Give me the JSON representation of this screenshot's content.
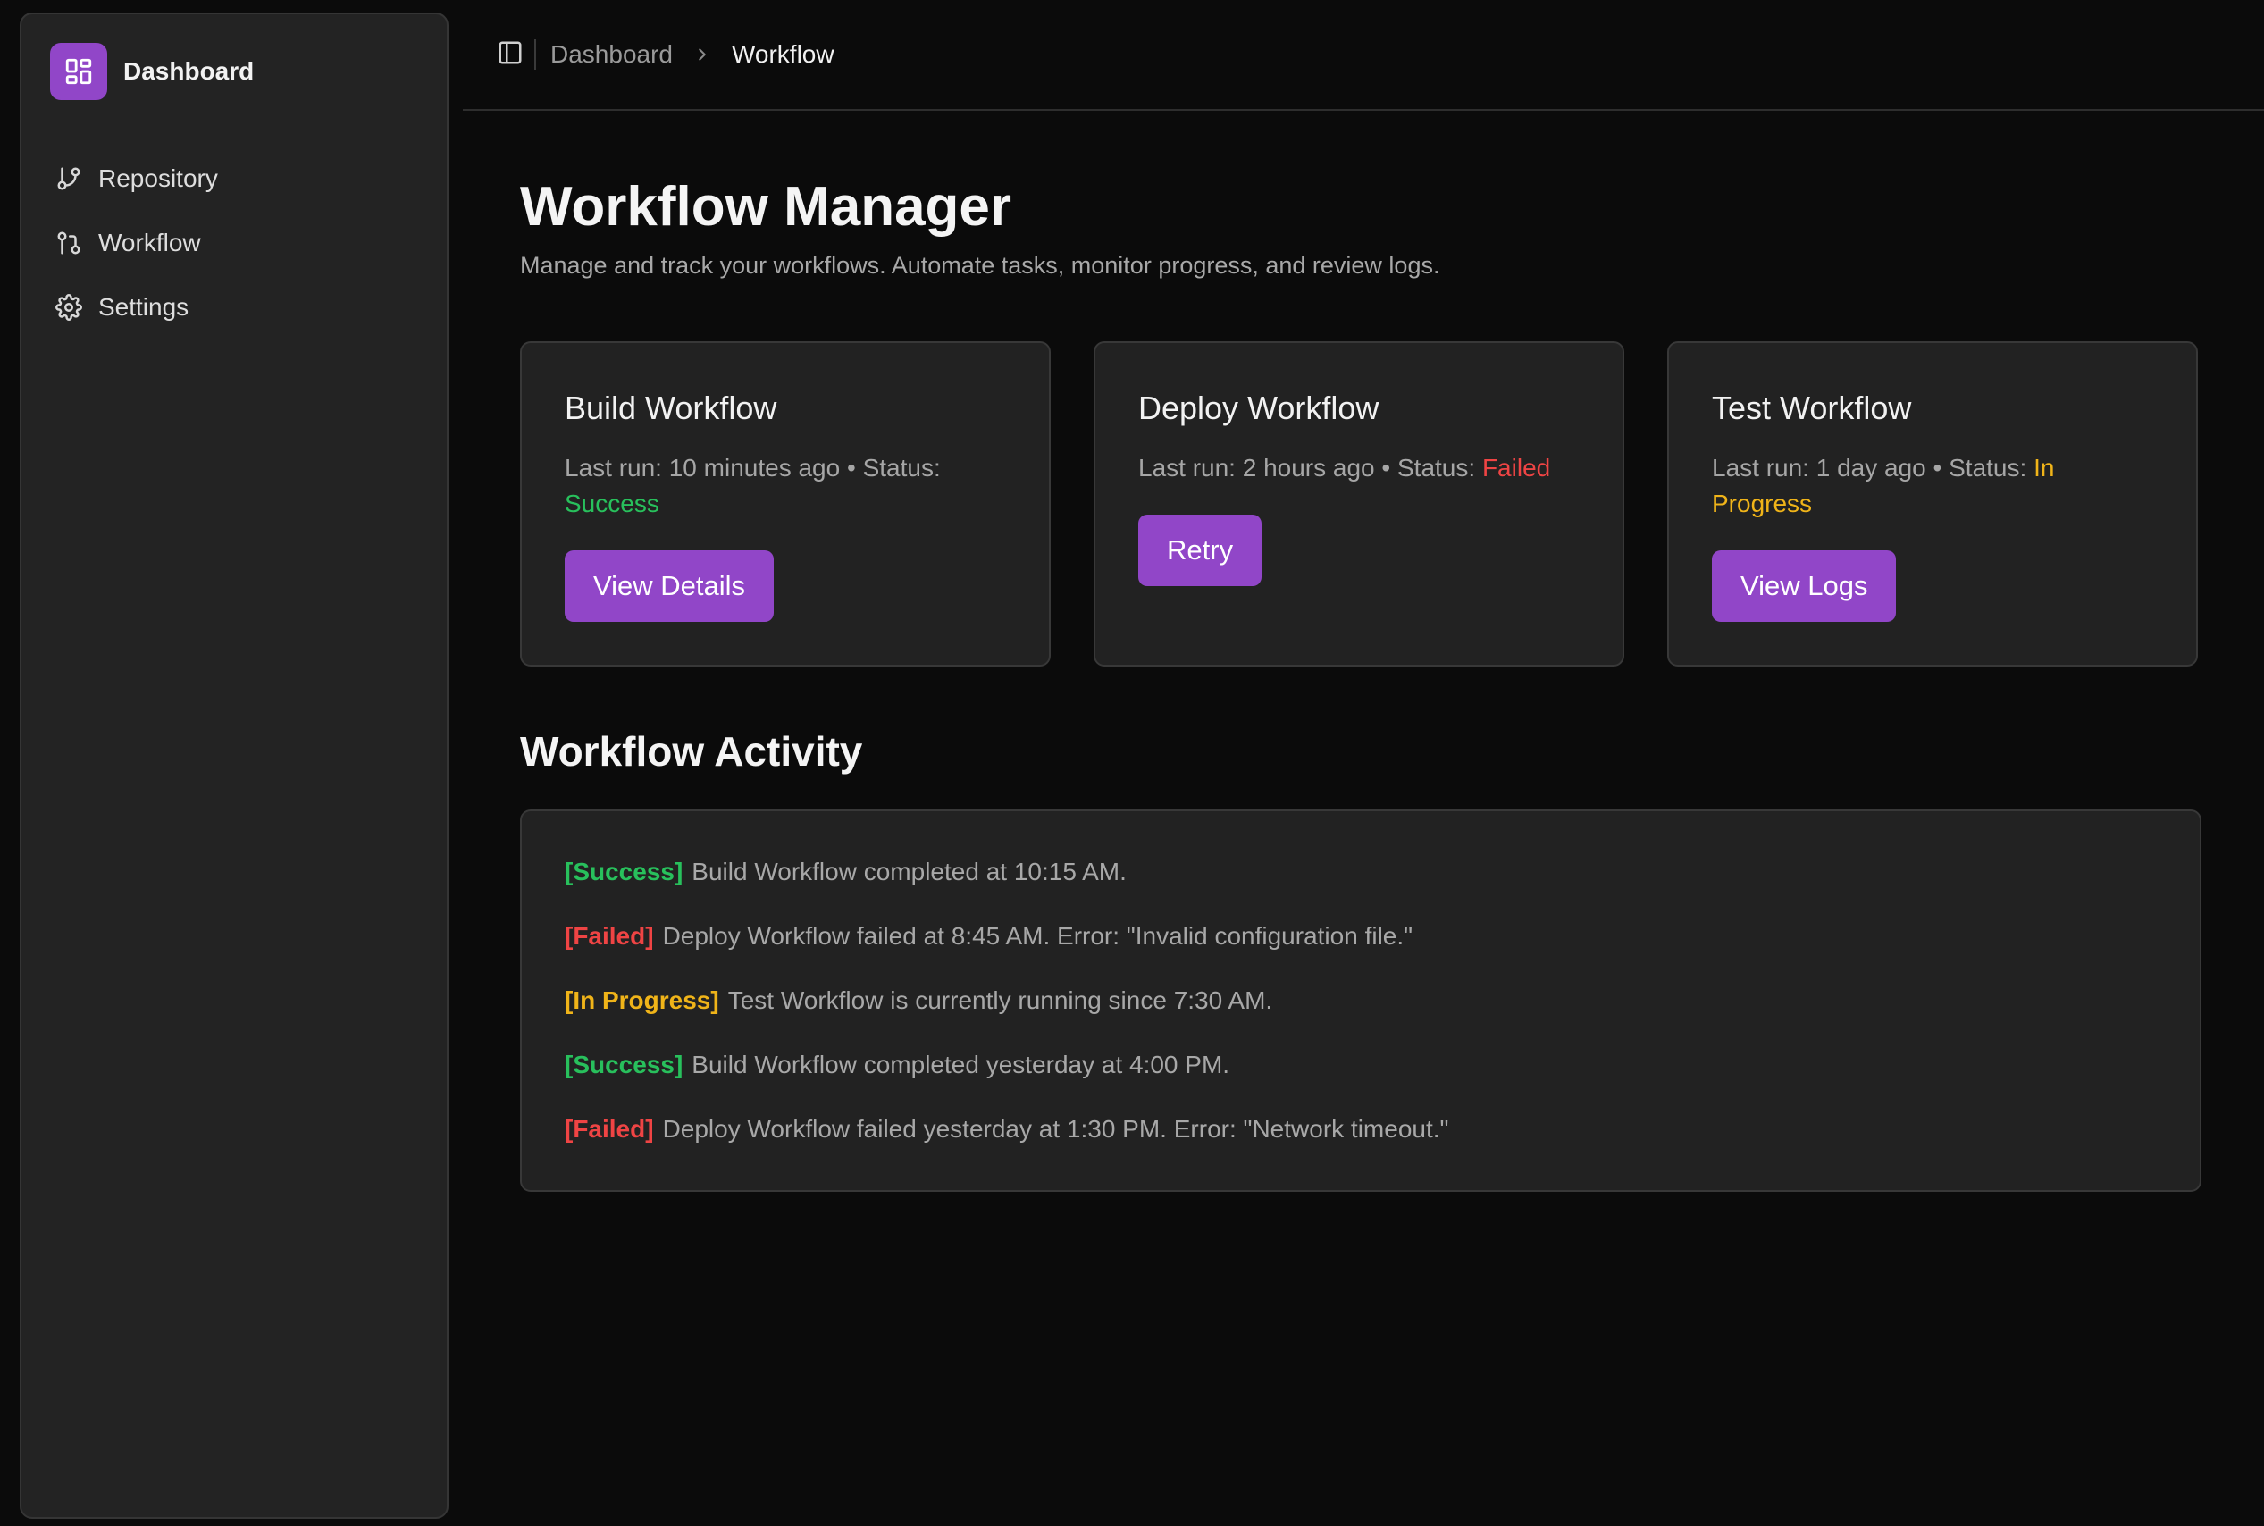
{
  "colors": {
    "accent": "#9146c8",
    "success": "#28c05c",
    "failed": "#ef4444",
    "in_progress": "#f0b419",
    "background": "#0b0b0b",
    "panel": "#232323"
  },
  "sidebar": {
    "brand": {
      "name": "Dashboard",
      "icon": "layout-dashboard-icon"
    },
    "items": [
      {
        "label": "Repository",
        "icon": "git-branch-icon"
      },
      {
        "label": "Workflow",
        "icon": "git-pull-request-icon"
      },
      {
        "label": "Settings",
        "icon": "gear-icon"
      }
    ]
  },
  "header": {
    "toggle_icon": "panel-left-icon",
    "breadcrumb": {
      "parent": "Dashboard",
      "separator_icon": "chevron-right-icon",
      "current": "Workflow"
    }
  },
  "main": {
    "title": "Workflow Manager",
    "subtitle": "Manage and track your workflows. Automate tasks, monitor progress, and review logs.",
    "cards": [
      {
        "title": "Build Workflow",
        "last_run": "Last run: 10 minutes ago",
        "dot": "•",
        "status_label": "Status:",
        "status": "Success",
        "button": "View Details"
      },
      {
        "title": "Deploy Workflow",
        "last_run": "Last run: 2 hours ago",
        "dot": "•",
        "status_label": "Status:",
        "status": "Failed",
        "button": "Retry"
      },
      {
        "title": "Test Workflow",
        "last_run": "Last run: 1 day ago",
        "dot": "•",
        "status_label": "Status:",
        "status": "In Progress",
        "button": "View Logs"
      }
    ],
    "activity_title": "Workflow Activity",
    "activity": [
      {
        "tag": "[Success]",
        "text": "Build Workflow completed at 10:15 AM."
      },
      {
        "tag": "[Failed]",
        "text": "Deploy Workflow failed at 8:45 AM. Error: \"Invalid configuration file.\""
      },
      {
        "tag": "[In Progress]",
        "text": "Test Workflow is currently running since 7:30 AM."
      },
      {
        "tag": "[Success]",
        "text": "Build Workflow completed yesterday at 4:00 PM."
      },
      {
        "tag": "[Failed]",
        "text": "Deploy Workflow failed yesterday at 1:30 PM. Error: \"Network timeout.\""
      }
    ]
  }
}
